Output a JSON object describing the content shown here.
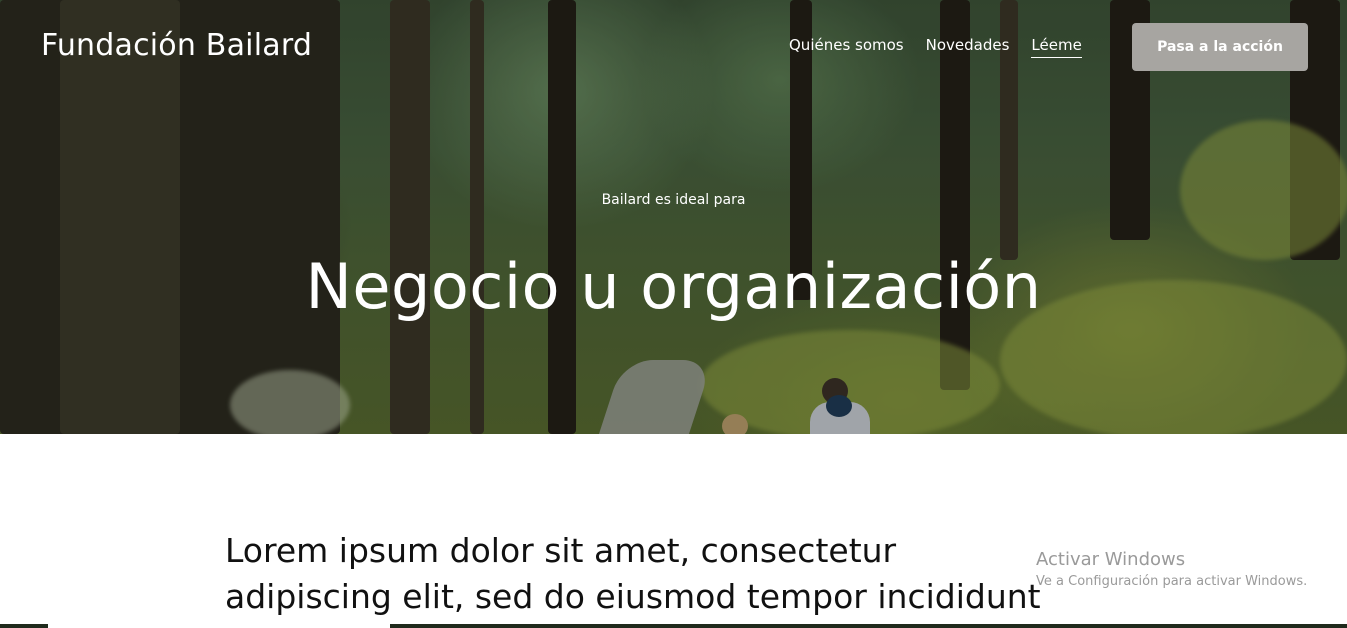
{
  "header": {
    "brand": "Fundación Bailard",
    "nav": [
      {
        "label": "Quiénes somos",
        "active": false
      },
      {
        "label": "Novedades",
        "active": false
      },
      {
        "label": "Léeme",
        "active": true
      }
    ],
    "cta_label": "Pasa a la acción"
  },
  "hero": {
    "kicker": "Bailard es ideal para",
    "title": "Negocio u organización"
  },
  "content": {
    "intro_line1": "Lorem ipsum dolor sit amet, consectetur",
    "intro_line2": "adipiscing elit, sed do eiusmod tempor incididunt"
  },
  "watermark": {
    "title": "Activar Windows",
    "subtitle": "Ve a Configuración para activar Windows."
  },
  "colors": {
    "cta_bg": "#a7a5a1",
    "text_dark": "#111111",
    "hero_text": "#ffffff"
  }
}
